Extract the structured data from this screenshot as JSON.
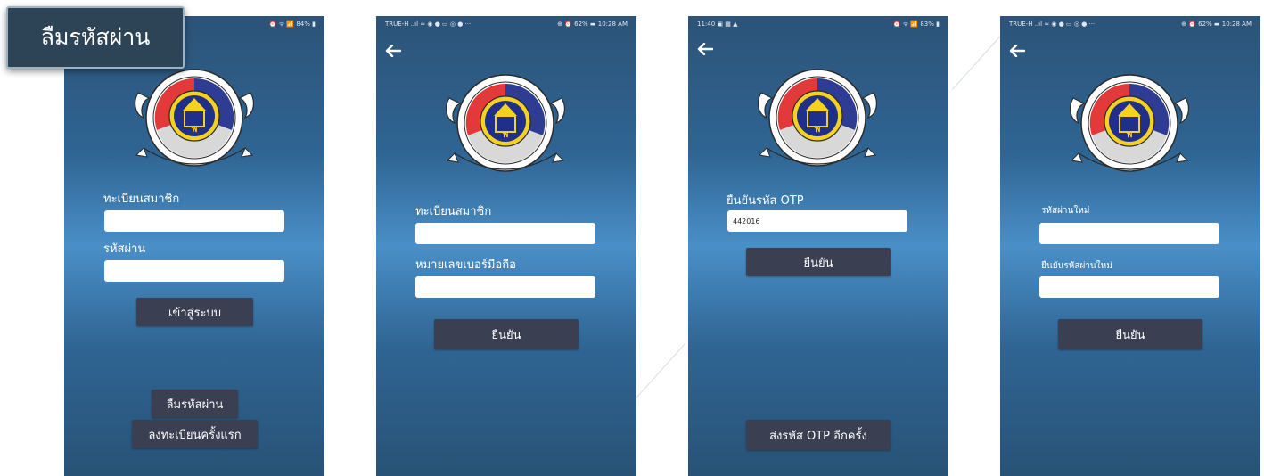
{
  "caption": "ลืมรหัสผ่าน",
  "colors": {
    "screen_top": "#2c5378",
    "screen_mid": "#4a8fc8",
    "button": "#3a3f52",
    "caption_bg": "#2d4456"
  },
  "screen1": {
    "status_right": "⏰ ᯤ 📶 84% ▮",
    "logo_icon": "cooperative-seal-logo",
    "member_label": "ทะเบียนสมาชิก",
    "member_value": "",
    "password_label": "รหัสผ่าน",
    "password_value": "",
    "login_button": "เข้าสู่ระบบ",
    "forgot_button": "ลืมรหัสผ่าน",
    "register_button": "ลงทะเบียนครั้งแรก"
  },
  "screen2": {
    "status_left": "TRUE-H ..ıl ≈ ◉ ● ▭ ◎ ● ···",
    "status_right": "⊕ ⏰ 62% ▬ 10:28 AM",
    "back_icon": "back-arrow-icon",
    "member_label": "ทะเบียนสมาชิก",
    "member_value": "",
    "phone_label": "หมายเลขเบอร์มือถือ",
    "phone_value": "",
    "confirm_button": "ยืนยัน"
  },
  "screen3": {
    "status_left": "11:40 ▣ ▦ ▲",
    "status_right": "⏰ ᯤ 📶 83% ▮",
    "back_icon": "back-arrow-icon",
    "otp_label": "ยืนยันรหัส OTP",
    "otp_value": "442016",
    "confirm_button": "ยืนยัน",
    "resend_button": "ส่งรหัส OTP อีกครั้ง"
  },
  "screen4": {
    "status_left": "TRUE-H ..ıl ≈ ◉ ● ▭ ◎ ● ···",
    "status_right": "⊕ ⏰ 62% ▬ 10:28 AM",
    "back_icon": "back-arrow-icon",
    "new_password_label": "รหัสผ่านใหม่",
    "new_password_value": "",
    "confirm_new_password_label": "ยืนยันรหัสผ่านใหม่",
    "confirm_new_password_value": "",
    "confirm_button": "ยืนยัน"
  }
}
